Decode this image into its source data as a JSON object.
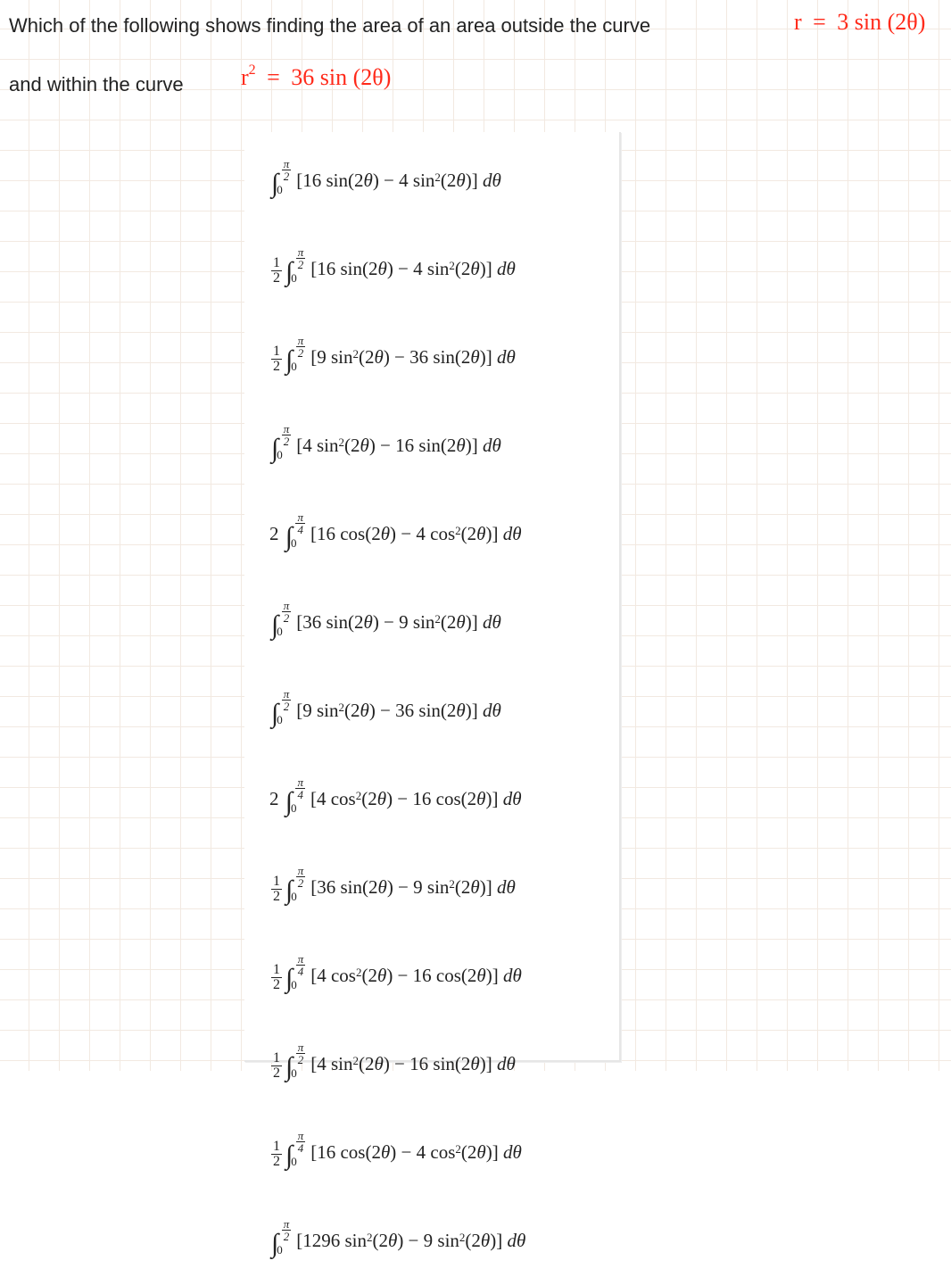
{
  "question": {
    "line1": "Which of the following shows finding the area of an area outside the curve",
    "line2": "and within the curve"
  },
  "handwritten": {
    "eq1_r": "r",
    "eq1_eq": "=",
    "eq1_rhs": "3 sin (2θ)",
    "eq2_r": "r",
    "eq2_sup": "2",
    "eq2_eq": "=",
    "eq2_rhs": "36 sin (2θ)"
  },
  "options": [
    {
      "lead": "",
      "upper": "π/2",
      "body": "[16 sin(2θ) − 4 sin²(2θ)] dθ"
    },
    {
      "lead": "1/2",
      "upper": "π/2",
      "body": "[16 sin(2θ) − 4 sin²(2θ)] dθ"
    },
    {
      "lead": "1/2",
      "upper": "π/2",
      "body": "[9 sin²(2θ) − 36 sin(2θ)] dθ"
    },
    {
      "lead": "",
      "upper": "π/2",
      "body": "[4 sin²(2θ) − 16 sin(2θ)] dθ"
    },
    {
      "lead": "2",
      "upper": "π/4",
      "body": "[16 cos(2θ) − 4 cos²(2θ)] dθ"
    },
    {
      "lead": "",
      "upper": "π/2",
      "body": "[36 sin(2θ) − 9 sin²(2θ)] dθ"
    },
    {
      "lead": "",
      "upper": "π/2",
      "body": "[9 sin²(2θ) − 36 sin(2θ)] dθ"
    },
    {
      "lead": "2",
      "upper": "π/4",
      "body": "[4 cos²(2θ) − 16 cos(2θ)] dθ"
    },
    {
      "lead": "1/2",
      "upper": "π/2",
      "body": "[36 sin(2θ) − 9 sin²(2θ)] dθ"
    },
    {
      "lead": "1/2",
      "upper": "π/4",
      "body": "[4 cos²(2θ) − 16 cos(2θ)] dθ"
    },
    {
      "lead": "1/2",
      "upper": "π/2",
      "body": "[4 sin²(2θ) − 16 sin(2θ)] dθ"
    },
    {
      "lead": "1/2",
      "upper": "π/4",
      "body": "[16 cos(2θ) − 4 cos²(2θ)] dθ"
    },
    {
      "lead": "",
      "upper": "π/2",
      "body": "[1296 sin²(2θ) − 9 sin²(2θ)] dθ"
    }
  ]
}
